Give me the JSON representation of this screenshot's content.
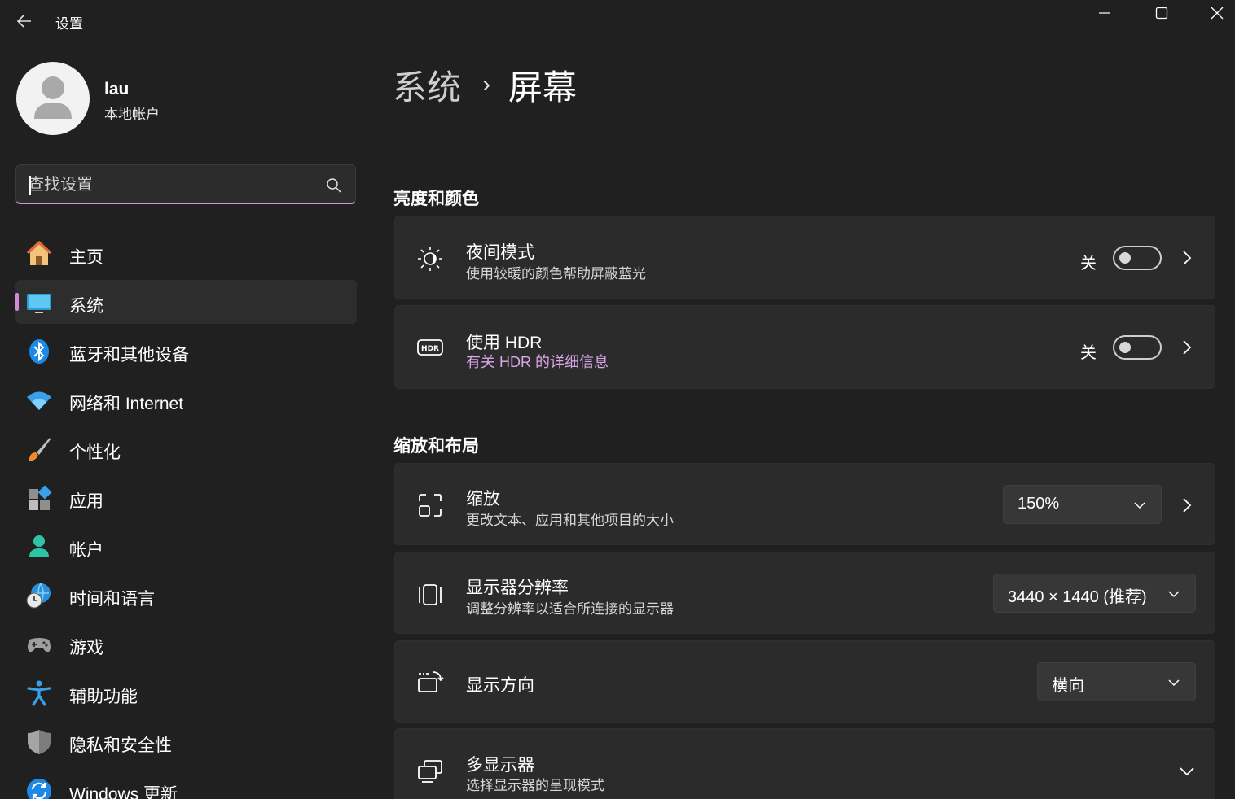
{
  "window": {
    "title": "设置",
    "controls": {
      "minimize": "minimize-icon",
      "maximize": "maximize-icon",
      "close": "close-icon"
    }
  },
  "profile": {
    "name": "lau",
    "account_type": "本地帐户"
  },
  "search": {
    "placeholder": "查找设置",
    "value": ""
  },
  "sidebar": {
    "items": [
      {
        "label": "主页",
        "icon": "home-icon",
        "active": false
      },
      {
        "label": "系统",
        "icon": "system-icon",
        "active": true
      },
      {
        "label": "蓝牙和其他设备",
        "icon": "bluetooth-icon",
        "active": false
      },
      {
        "label": "网络和 Internet",
        "icon": "wifi-icon",
        "active": false
      },
      {
        "label": "个性化",
        "icon": "brush-icon",
        "active": false
      },
      {
        "label": "应用",
        "icon": "apps-icon",
        "active": false
      },
      {
        "label": "帐户",
        "icon": "person-icon",
        "active": false
      },
      {
        "label": "时间和语言",
        "icon": "globe-clock-icon",
        "active": false
      },
      {
        "label": "游戏",
        "icon": "gamepad-icon",
        "active": false
      },
      {
        "label": "辅助功能",
        "icon": "accessibility-icon",
        "active": false
      },
      {
        "label": "隐私和安全性",
        "icon": "shield-icon",
        "active": false
      },
      {
        "label": "Windows 更新",
        "icon": "update-icon",
        "active": false
      }
    ]
  },
  "breadcrumb": {
    "parent": "系统",
    "separator": "›",
    "current": "屏幕"
  },
  "sections": {
    "brightness": {
      "title": "亮度和颜色",
      "night_light": {
        "title": "夜间模式",
        "description": "使用较暖的颜色帮助屏蔽蓝光",
        "state_label": "关",
        "icon": "night-light-icon"
      },
      "hdr": {
        "title": "使用 HDR",
        "link": "有关 HDR 的详细信息",
        "state_label": "关",
        "icon": "hdr-icon"
      }
    },
    "scale_layout": {
      "title": "缩放和布局",
      "scale": {
        "title": "缩放",
        "description": "更改文本、应用和其他项目的大小",
        "value": "150%",
        "icon": "scale-icon"
      },
      "resolution": {
        "title": "显示器分辨率",
        "description": "调整分辨率以适合所连接的显示器",
        "value": "3440 × 1440 (推荐)",
        "icon": "resolution-icon"
      },
      "orientation": {
        "title": "显示方向",
        "value": "横向",
        "icon": "orientation-icon"
      },
      "multi_display": {
        "title": "多显示器",
        "description": "选择显示器的呈现模式",
        "icon": "multi-display-icon"
      }
    }
  },
  "colors": {
    "accent": "#d18ad9",
    "link": "#dba5ea",
    "background": "#202020",
    "card": "#2b2b2b"
  }
}
